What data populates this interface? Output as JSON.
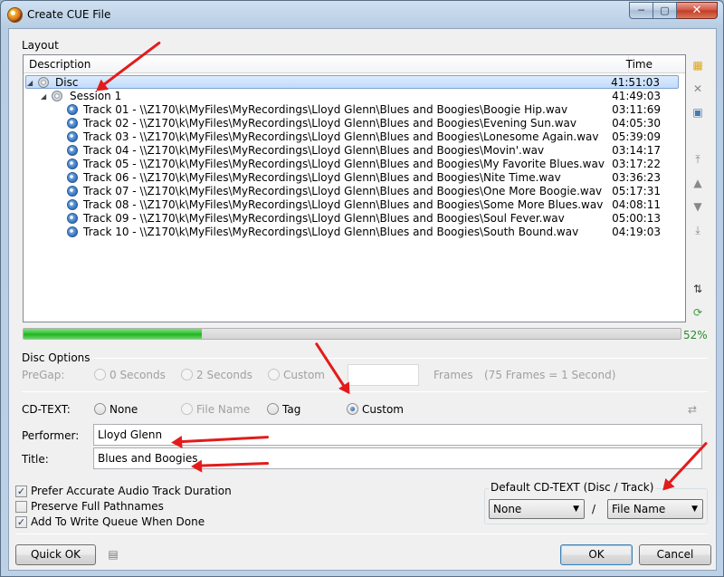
{
  "window": {
    "title": "Create CUE File"
  },
  "layout": {
    "group_label": "Layout",
    "columns": {
      "description": "Description",
      "time": "Time"
    },
    "disc": {
      "label": "Disc",
      "time": "41:51:03"
    },
    "session": {
      "label": "Session 1",
      "time": "41:49:03"
    },
    "tracks": [
      {
        "label": "Track 01 - \\\\Z170\\k\\MyFiles\\MyRecordings\\Lloyd Glenn\\Blues and Boogies\\Boogie Hip.wav",
        "time": "03:11:69"
      },
      {
        "label": "Track 02 - \\\\Z170\\k\\MyFiles\\MyRecordings\\Lloyd Glenn\\Blues and Boogies\\Evening Sun.wav",
        "time": "04:05:30"
      },
      {
        "label": "Track 03 - \\\\Z170\\k\\MyFiles\\MyRecordings\\Lloyd Glenn\\Blues and Boogies\\Lonesome Again.wav",
        "time": "05:39:09"
      },
      {
        "label": "Track 04 - \\\\Z170\\k\\MyFiles\\MyRecordings\\Lloyd Glenn\\Blues and Boogies\\Movin'.wav",
        "time": "03:14:17"
      },
      {
        "label": "Track 05 - \\\\Z170\\k\\MyFiles\\MyRecordings\\Lloyd Glenn\\Blues and Boogies\\My Favorite Blues.wav",
        "time": "03:17:22"
      },
      {
        "label": "Track 06 - \\\\Z170\\k\\MyFiles\\MyRecordings\\Lloyd Glenn\\Blues and Boogies\\Nite Time.wav",
        "time": "03:36:23"
      },
      {
        "label": "Track 07 - \\\\Z170\\k\\MyFiles\\MyRecordings\\Lloyd Glenn\\Blues and Boogies\\One More Boogie.wav",
        "time": "05:17:31"
      },
      {
        "label": "Track 08 - \\\\Z170\\k\\MyFiles\\MyRecordings\\Lloyd Glenn\\Blues and Boogies\\Some More Blues.wav",
        "time": "04:08:11"
      },
      {
        "label": "Track 09 - \\\\Z170\\k\\MyFiles\\MyRecordings\\Lloyd Glenn\\Blues and Boogies\\Soul Fever.wav",
        "time": "05:00:13"
      },
      {
        "label": "Track 10 - \\\\Z170\\k\\MyFiles\\MyRecordings\\Lloyd Glenn\\Blues and Boogies\\South Bound.wav",
        "time": "04:19:03"
      }
    ],
    "side_tool_icons": [
      "folder-add-icon",
      "delete-icon",
      "properties-icon",
      "move-top-icon",
      "move-up-icon",
      "move-down-icon",
      "move-bottom-icon",
      "sort-icon",
      "refresh-icon"
    ]
  },
  "progress": {
    "value": 0.52,
    "text": "52%",
    "color": "#2ec12e"
  },
  "disc_options": {
    "label": "Disc Options",
    "pregap_label": "PreGap:",
    "pregap_options": [
      "0 Seconds",
      "2 Seconds",
      "Custom"
    ],
    "frames_label": "Frames",
    "frames_hint": "(75 Frames = 1 Second)",
    "frames_value": ""
  },
  "cdtext": {
    "label": "CD-TEXT:",
    "options": [
      "None",
      "File Name",
      "Tag",
      "Custom"
    ],
    "selected": "Custom",
    "performer_label": "Performer:",
    "performer_value": "Lloyd Glenn",
    "title_label": "Title:",
    "title_value": "Blues and Boogies"
  },
  "checkboxes": [
    {
      "label": "Prefer Accurate Audio Track Duration",
      "checked": true
    },
    {
      "label": "Preserve Full Pathnames",
      "checked": false
    },
    {
      "label": "Add To Write Queue When Done",
      "checked": true
    }
  ],
  "default_cdtext": {
    "label": "Default CD-TEXT (Disc / Track)",
    "disc_value": "None",
    "separator": "/",
    "track_value": "File Name"
  },
  "buttons": {
    "quick_ok": "Quick OK",
    "ok": "OK",
    "cancel": "Cancel"
  },
  "annotation_color": "#e31b1b"
}
